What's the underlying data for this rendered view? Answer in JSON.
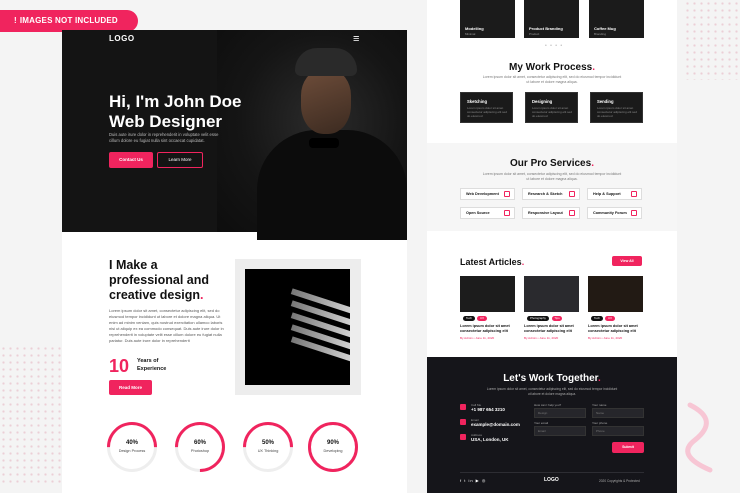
{
  "banner": {
    "icon": "!",
    "text": "IMAGES NOT INCLUDED"
  },
  "hero": {
    "logo": "LOGO",
    "menu_icon": "hamburger-icon",
    "title_line1": "Hi, I'm John Doe",
    "title_line2": "Web Designer",
    "description": "Duis aute irure dolor in reprehenderit in voluptate velit esse cillum dolore eu fugiat nulla sint occaecat cupidatat.",
    "btn_primary": "Contact Us",
    "btn_secondary": "Learn More"
  },
  "about": {
    "title_line1": "I Make a",
    "title_line2": "professional and",
    "title_line3": "creative design",
    "description": "Lorem ipsum dolor sit amet, consectetur adipiscing elit, sed do eiusmod tempor incididunt ut labore et dolore magna aliqua. Ut enim ad minim veniam, quis nostrud exercitation ullamco laboris nisi ut aliquip ex ea commodo consequat. Duis aute irure dolor in reprehenderit in voluptate velit esse cillum dolore eu fugiat nulla pariatur. Duis aute irure dolor in reprehenderit",
    "years_number": "10",
    "years_label": "Years of Experience",
    "button": "Read More"
  },
  "skills": [
    {
      "value": "40%",
      "label": "Design Process",
      "percent": 40
    },
    {
      "value": "60%",
      "label": "Photoshop",
      "percent": 60
    },
    {
      "value": "50%",
      "label": "UX Thinking",
      "percent": 50
    },
    {
      "value": "90%",
      "label": "Developing",
      "percent": 90
    }
  ],
  "portfolio": {
    "items": [
      {
        "title": "Modelling",
        "sub": "Minimal"
      },
      {
        "title": "Product Branding",
        "sub": "Product"
      },
      {
        "title": "Coffee Mug",
        "sub": "Branding"
      }
    ],
    "dots": "• • • •"
  },
  "process": {
    "title": "My Work Process",
    "subtitle": "Lorem ipsum dolor sit amet, consectetur adipiscing elit, sed do eiusmod tempor incididunt ut labore et dolore magna aliqua.",
    "steps": [
      {
        "name": "Sketching",
        "desc": "Lorem ipsum dolor sit amet consectetur adipiscing elit sed do eiusmod"
      },
      {
        "name": "Designing",
        "desc": "Lorem ipsum dolor sit amet consectetur adipiscing elit sed do eiusmod"
      },
      {
        "name": "Sending",
        "desc": "Lorem ipsum dolor sit amet consectetur adipiscing elit sed do eiusmod"
      }
    ]
  },
  "services": {
    "title": "Our Pro Services",
    "subtitle": "Lorem ipsum dolor sit amet, consectetur adipiscing elit, sed do eiusmod tempor incididunt ut labore et dolore magna aliqua.",
    "items": [
      "Web Development",
      "Research & Sketch",
      "Help & Support",
      "Open Source",
      "Responsive Layout",
      "Community Forum"
    ]
  },
  "articles": {
    "title": "Latest Articles",
    "button": "View All",
    "items": [
      {
        "tags": [
          "Tech",
          "UX"
        ],
        "title": "Lorem ipsum dolor sit amet consectetur adipiscing elit",
        "meta": "By Admin  •  June 11, 2020"
      },
      {
        "tags": [
          "Photography",
          "Tips"
        ],
        "title": "Lorem ipsum dolor sit amet consectetur adipiscing elit",
        "meta": "By Admin  •  June 11, 2020"
      },
      {
        "tags": [
          "Tech",
          "UX"
        ],
        "title": "Lorem ipsum dolor sit amet consectetur adipiscing elit",
        "meta": "By Admin  •  June 11, 2020"
      }
    ]
  },
  "contact": {
    "title": "Let's Work Together",
    "subtitle": "Lorem ipsum dolor sit amet, consectetur adipiscing elit, sed do eiusmod tempor incididunt ut labore et dolore magna aliqua.",
    "phone_label": "Call Me",
    "phone": "+1 987 654 3210",
    "email_label": "Email",
    "email": "example@domain.com",
    "address_label": "Address",
    "address": "USA, London, UK",
    "form": {
      "label1": "How can I help you?",
      "label2": "Your name",
      "label3": "Your email",
      "label4": "Your phone",
      "ph1": "Design",
      "ph2": "Name",
      "ph3": "Email",
      "ph4": "Phone"
    },
    "send": "Submit"
  },
  "footer": {
    "social": "f t in ▶ ◎",
    "logo": "LOGO",
    "copyright": "2020 Copyrights & Protected"
  },
  "colors": {
    "accent": "#f0245e",
    "dark": "#141414"
  }
}
